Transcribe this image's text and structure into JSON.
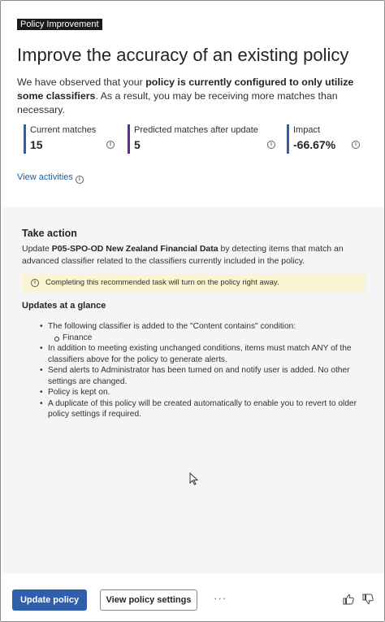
{
  "tag": "Policy Improvement",
  "title": "Improve the accuracy of an existing policy",
  "description": {
    "pre": "We have observed that your ",
    "bold": "policy is currently configured to only utilize some classifiers",
    "post": ". As a result, you may be receiving more matches than necessary."
  },
  "metrics": [
    {
      "label": "Current matches",
      "value": "15",
      "color": "#2f5eaa"
    },
    {
      "label": "Predicted matches after update",
      "value": "5",
      "color": "#5c2e91"
    },
    {
      "label": "Impact",
      "value": "-66.67%",
      "color": "#2f5eaa"
    }
  ],
  "view_activities": "View activities",
  "take_action": {
    "title": "Take action",
    "pre": "Update ",
    "bold": "P05-SPO-OD New Zealand Financial Data",
    "post": " by detecting items that match an advanced classifier related to the classifiers currently included in the policy."
  },
  "notice": "Completing this recommended task will turn on the policy right away.",
  "glance_title": "Updates at a glance",
  "updates": [
    "The following classifier is added to the \"Content contains\" condition:",
    "Finance",
    "In addition to meeting existing unchanged conditions, items must match ANY of the classifiers above for the policy to generate alerts.",
    "Send alerts to Administrator has been turned on and notify user is added. No other settings are changed.",
    "Policy is kept on.",
    "A duplicate of this policy will be created automatically to enable you to revert to older policy settings if required."
  ],
  "buttons": {
    "update": "Update policy",
    "view_settings": "View policy settings",
    "more": "···"
  },
  "colors": {
    "accent": "#2f5eaa",
    "notice_bg": "#fbf4d3",
    "link": "#1a5ea6"
  }
}
